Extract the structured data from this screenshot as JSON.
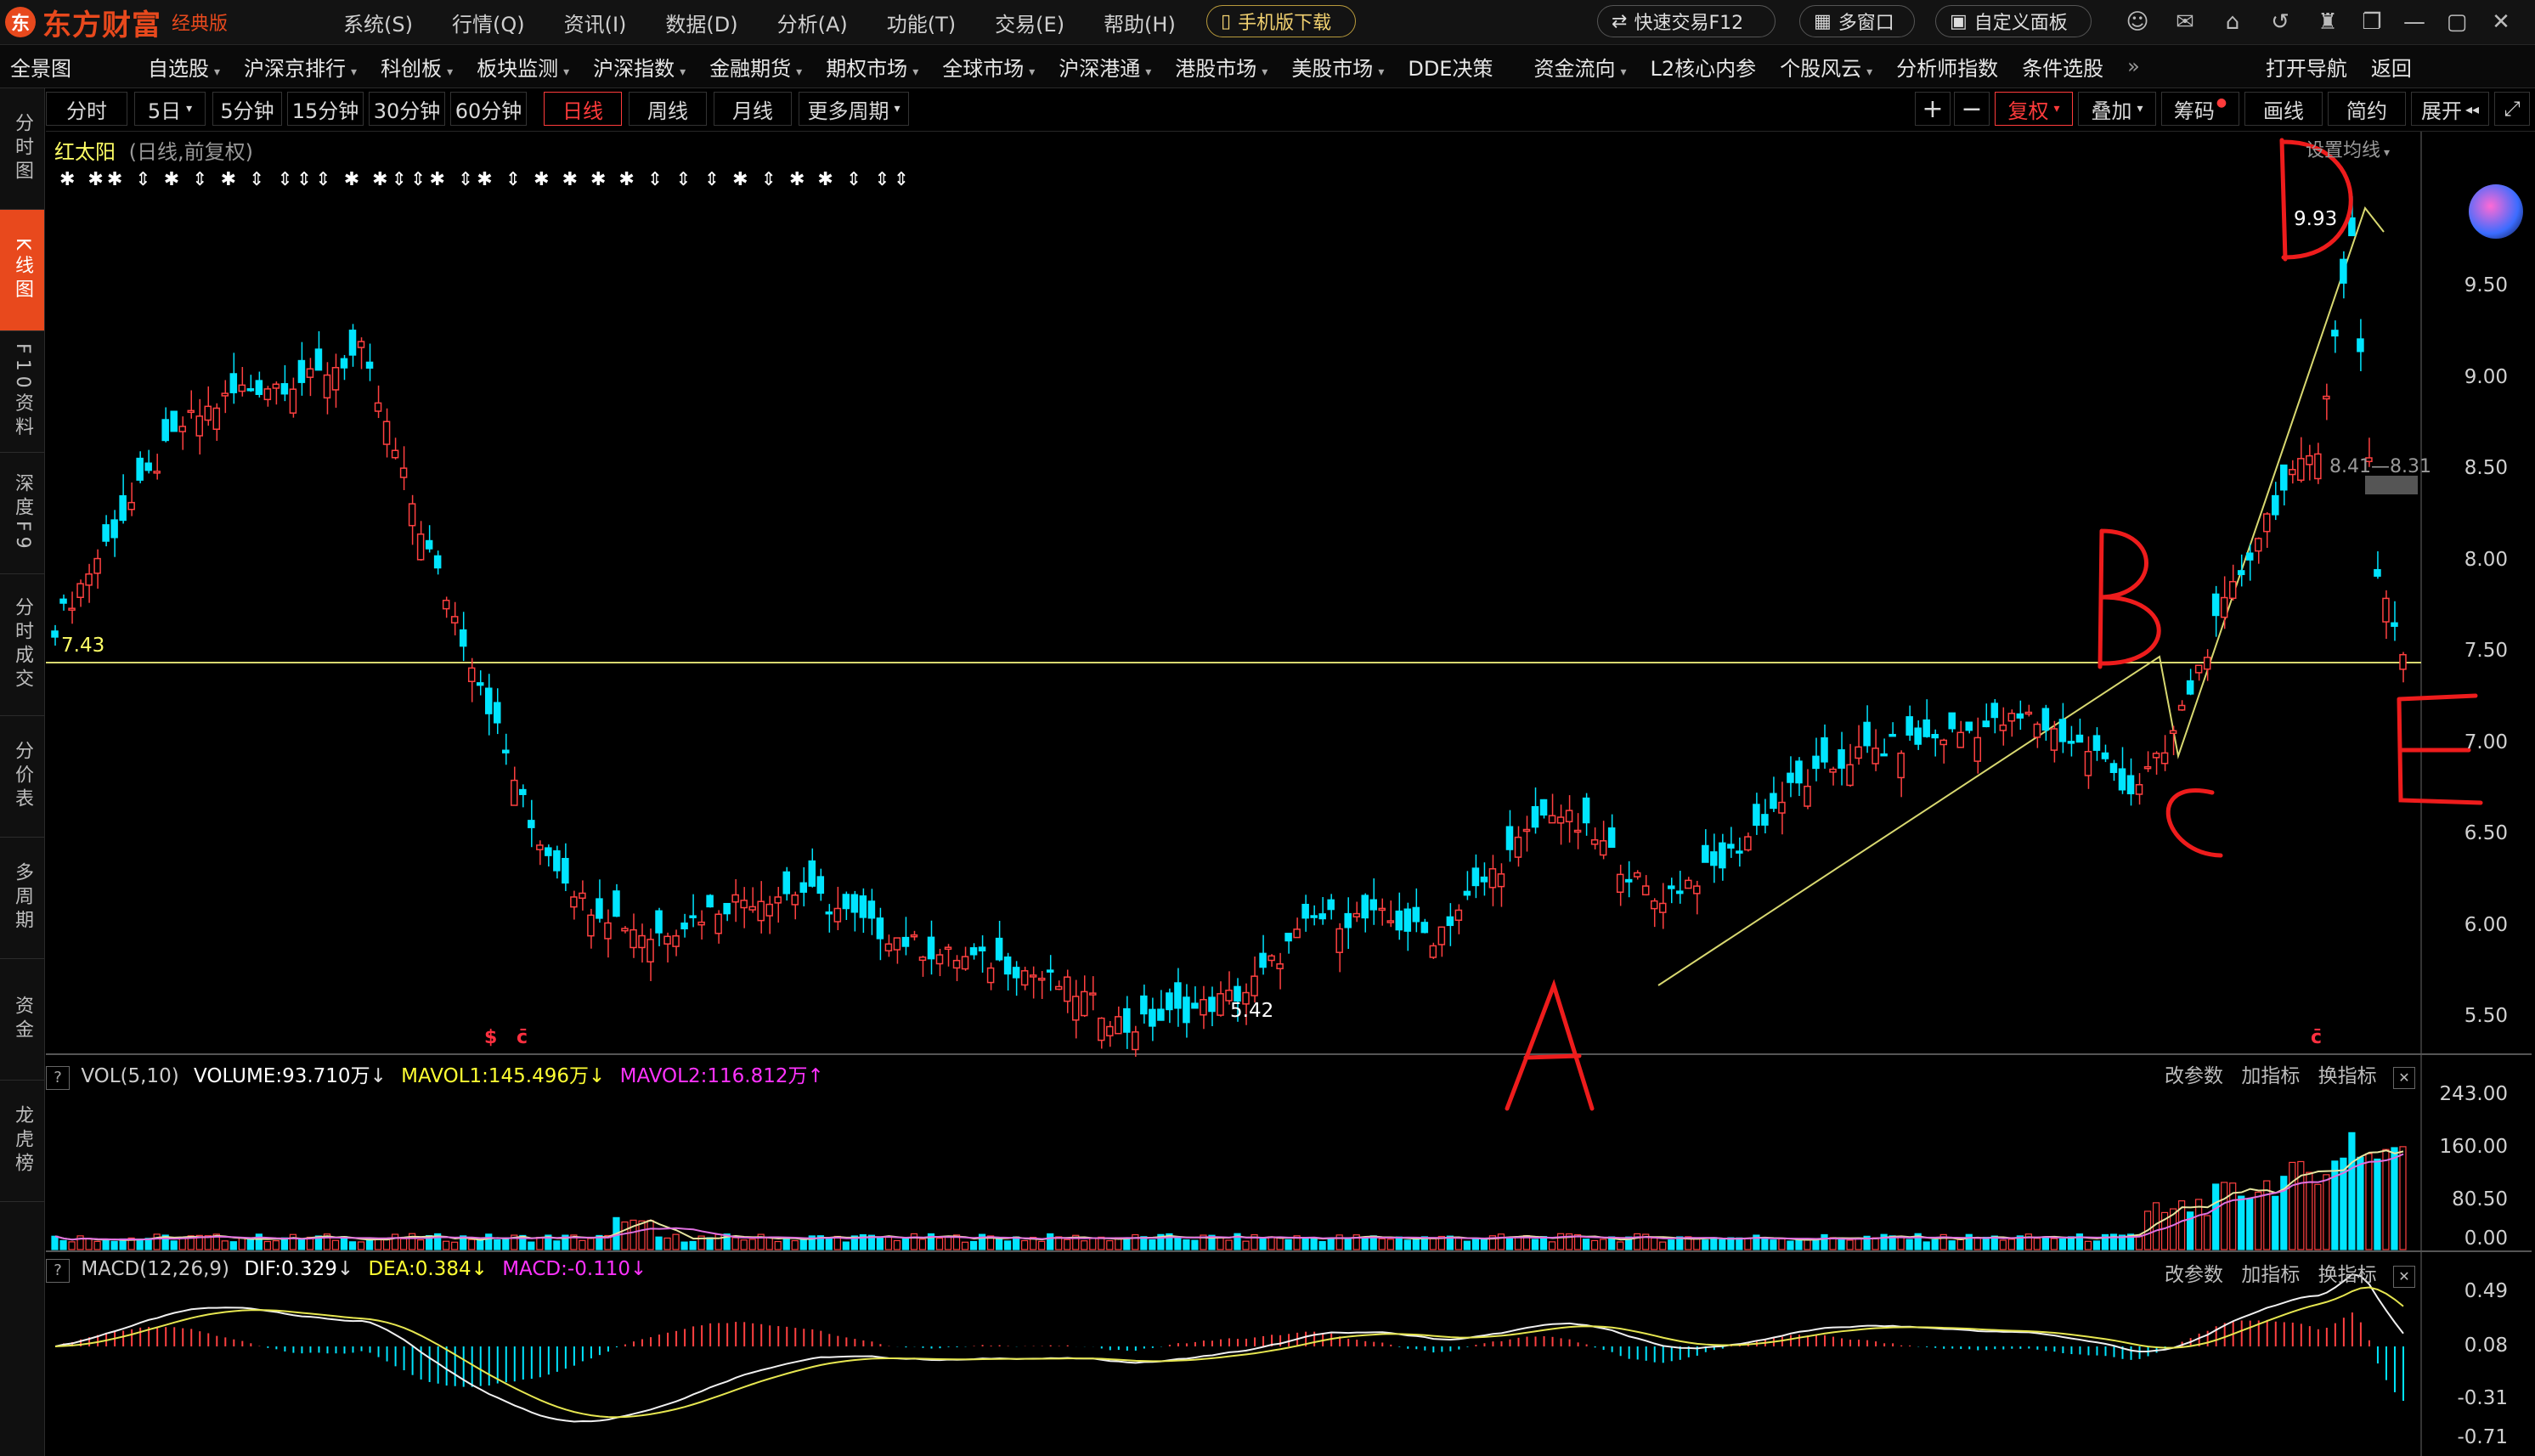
{
  "app": {
    "logo_text": "东方财富",
    "edition": "经典版",
    "menu": [
      "系统(S)",
      "行情(Q)",
      "资讯(I)",
      "数据(D)",
      "分析(A)",
      "功能(T)",
      "交易(E)",
      "帮助(H)"
    ],
    "mobile_download": "手机版下载",
    "quick_trade": "快速交易F12",
    "multi_window": "多窗口",
    "custom_panel": "自定义面板"
  },
  "nav": {
    "items": [
      "全景图",
      "自选股",
      "沪深京排行",
      "科创板",
      "板块监测",
      "沪深指数",
      "金融期货",
      "期权市场",
      "全球市场",
      "沪深港通",
      "港股市场",
      "美股市场",
      "DDE决策",
      "资金流向",
      "L2核心内参",
      "个股风云",
      "分析师指数",
      "条件选股"
    ],
    "more": "»",
    "open_nav": "打开导航",
    "back": "返回"
  },
  "periods": {
    "items": [
      "分时",
      "5日",
      "5分钟",
      "15分钟",
      "30分钟",
      "60分钟",
      "日线",
      "周线",
      "月线",
      "更多周期"
    ],
    "active": "日线",
    "right": {
      "plus": "+",
      "minus": "−",
      "fuquan": "复权",
      "overlay": "叠加",
      "chips": "筹码",
      "draw": "画线",
      "simple": "简约",
      "expand": "展开"
    }
  },
  "sidebar": {
    "items": [
      "分时图",
      "K线图",
      "F10资料",
      "深度F9",
      "分时成交",
      "分价表",
      "多周期",
      "资金",
      "龙虎榜"
    ],
    "active": "K线图"
  },
  "stock": {
    "name": "红太阳",
    "mode": "(日线,前复权)",
    "ma_setting": "设置均线"
  },
  "main_pane": {
    "y_ticks": [
      "9.50",
      "9.00",
      "8.50",
      "8.00",
      "7.50",
      "7.00",
      "6.50",
      "6.00",
      "5.50"
    ],
    "price_labels": {
      "high": "9.93",
      "low": "5.42",
      "left": "7.43",
      "crosshair": "8.41—8.31"
    },
    "annotations": [
      "A",
      "B",
      "C",
      "D",
      "E"
    ],
    "signal_row": "✱ ✱✱ ⇕ ✱ ⇕ ✱ ⇕ ⇕⇕⇕ ✱ ✱⇕⇕✱ ⇕✱ ⇕ ✱ ✱ ✱ ✱ ⇕ ⇕ ⇕ ✱ ⇕ ✱ ✱ ⇕ ⇕⇕"
  },
  "vol_pane": {
    "indicator": "VOL(5,10)",
    "volume": "VOLUME:93.710万",
    "mavol1": "MAVOL1:145.496万",
    "mavol2": "MAVOL2:116.812万",
    "y_ticks": [
      "243.00",
      "160.00",
      "80.50",
      "0.00"
    ],
    "tools": [
      "改参数",
      "加指标",
      "换指标"
    ]
  },
  "macd_pane": {
    "indicator": "MACD(12,26,9)",
    "dif": "DIF:0.329",
    "dea": "DEA:0.384",
    "macd": "MACD:-0.110",
    "y_ticks": [
      "0.49",
      "0.08",
      "-0.31",
      "-0.71"
    ],
    "tools": [
      "改参数",
      "加指标",
      "换指标"
    ]
  },
  "colors": {
    "up": "#ff4040",
    "down": "#00e5ff",
    "accent": "#e8491d",
    "yellow": "#ffff33",
    "magenta": "#ff33ff"
  }
}
